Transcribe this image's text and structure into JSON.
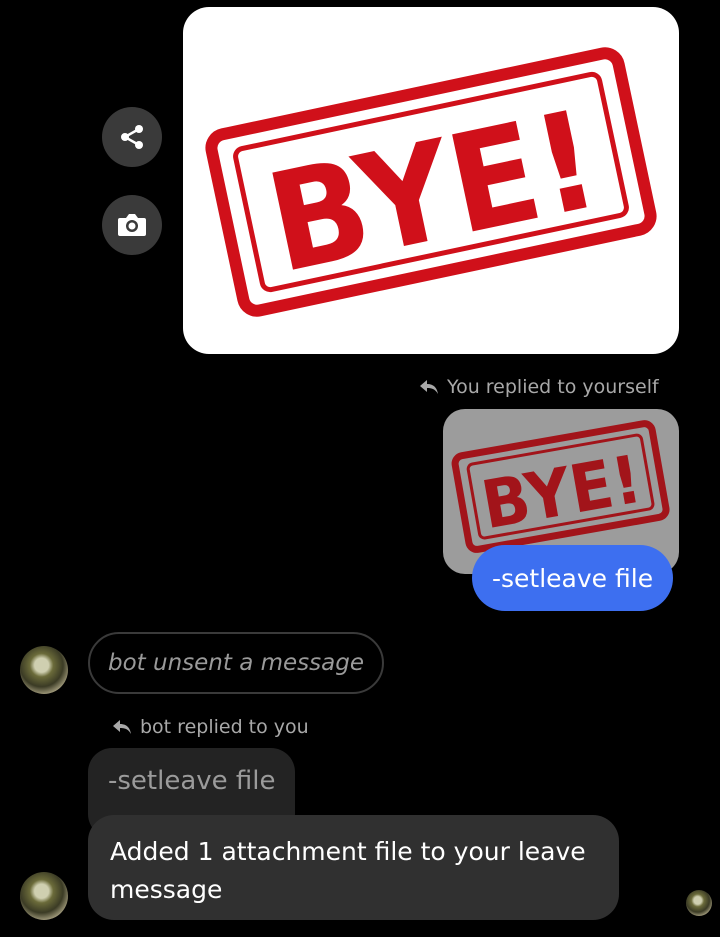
{
  "icons": {
    "share": "share-icon",
    "camera": "camera-icon",
    "reply": "reply-arrow-icon"
  },
  "image_text": "BYE!",
  "reply_self": "You replied to yourself",
  "sent_message": "-setleave file",
  "unsent_message": "bot unsent a message",
  "reply_bot": "bot replied to you",
  "quoted_message": "-setleave file",
  "bot_message": "Added 1 attachment file to your leave message",
  "colors": {
    "background": "#000000",
    "sent_bubble": "#3d6ff0",
    "received_bubble": "#303030",
    "stamp_red": "#d0101a"
  }
}
